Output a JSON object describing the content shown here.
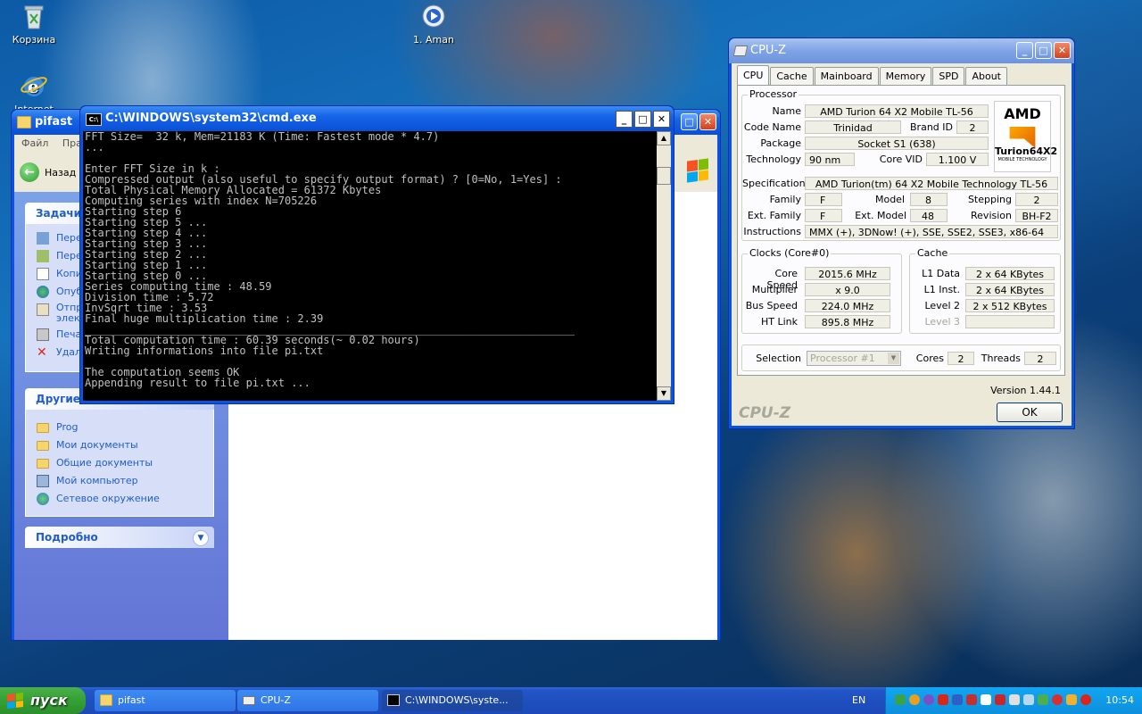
{
  "desktop": {
    "icons": [
      {
        "label": "Корзина"
      },
      {
        "label": "Internet"
      },
      {
        "label": "1. Aman"
      }
    ]
  },
  "explorer": {
    "title": "pifast",
    "menu": [
      "Файл",
      "Прав"
    ],
    "back_label": "Назад",
    "tasks_header": "Задачи",
    "tasks": [
      "Пере",
      "Пере",
      "Копи",
      "Опуб",
      "Отпр",
      "Печа",
      "Удал"
    ],
    "tasks_extra": "элект",
    "other_header": "Другие м",
    "other_places": [
      "Prog",
      "Мои документы",
      "Общие документы",
      "Мой компьютер",
      "Сетевое окружение"
    ],
    "details_header": "Подробно"
  },
  "cmd": {
    "title": "C:\\WINDOWS\\system32\\cmd.exe",
    "lines": [
      "FFT Size=  32 k, Mem=21183 K (Time: Fastest mode * 4.7)",
      "...",
      "",
      "Enter FFT Size in k :",
      "Compressed output (also useful to specify output format) ? [0=No, 1=Yes] :",
      "Total Physical Memory Allocated = 61372 Kbytes",
      "Computing series with index N=705226",
      "Starting step 6",
      "Starting step 5 ...",
      "Starting step 4 ...",
      "Starting step 3 ...",
      "Starting step 2 ...",
      "Starting step 1 ...",
      "Starting step 0 ...",
      "Series computing time : 48.59",
      "Division time : 5.72",
      "InvSqrt time : 3.53",
      "Final huge multiplication time : 2.39",
      "____________________________________________________________________________",
      "Total computation time : 60.39 seconds(~ 0.02 hours)",
      "Writing informations into file pi.txt",
      "",
      "The computation seems OK",
      "Appending result to file pi.txt ..."
    ]
  },
  "cpuz": {
    "title": "CPU-Z",
    "tabs": [
      "CPU",
      "Cache",
      "Mainboard",
      "Memory",
      "SPD",
      "About"
    ],
    "processor": {
      "group": "Processor",
      "name_label": "Name",
      "name": "AMD Turion 64 X2 Mobile TL-56",
      "codename_label": "Code Name",
      "codename": "Trinidad",
      "brandid_label": "Brand ID",
      "brandid": "2",
      "package_label": "Package",
      "package": "Socket S1 (638)",
      "technology_label": "Technology",
      "technology": "90 nm",
      "corevid_label": "Core VID",
      "corevid": "1.100 V",
      "spec_label": "Specification",
      "spec": "AMD Turion(tm) 64 X2 Mobile Technology TL-56",
      "family_label": "Family",
      "family": "F",
      "model_label": "Model",
      "model": "8",
      "stepping_label": "Stepping",
      "stepping": "2",
      "extfamily_label": "Ext. Family",
      "extfamily": "F",
      "extmodel_label": "Ext. Model",
      "extmodel": "48",
      "revision_label": "Revision",
      "revision": "BH-F2",
      "instr_label": "Instructions",
      "instr": "MMX (+), 3DNow! (+), SSE, SSE2, SSE3, x86-64"
    },
    "logo": {
      "brand": "AMD",
      "line1": "Turion64X2",
      "line2": "MOBILE TECHNOLOGY"
    },
    "clocks": {
      "group": "Clocks (Core#0)",
      "corespeed_label": "Core Speed",
      "corespeed": "2015.6 MHz",
      "multiplier_label": "Multiplier",
      "multiplier": "x 9.0",
      "busspeed_label": "Bus Speed",
      "busspeed": "224.0 MHz",
      "htlink_label": "HT Link",
      "htlink": "895.8 MHz"
    },
    "cache": {
      "group": "Cache",
      "l1d_label": "L1 Data",
      "l1d": "2 x 64 KBytes",
      "l1i_label": "L1 Inst.",
      "l1i": "2 x 64 KBytes",
      "l2_label": "Level 2",
      "l2": "2 x 512 KBytes",
      "l3_label": "Level 3",
      "l3": ""
    },
    "selection_label": "Selection",
    "selection_value": "Processor #1",
    "cores_label": "Cores",
    "cores": "2",
    "threads_label": "Threads",
    "threads": "2",
    "version": "Version 1.44.1",
    "brand": "CPU-Z",
    "ok_label": "OK"
  },
  "taskbar": {
    "start_label": "пуск",
    "buttons": [
      "pifast",
      "CPU-Z",
      "C:\\WINDOWS\\syste..."
    ],
    "lang": "EN",
    "clock": "10:54"
  }
}
